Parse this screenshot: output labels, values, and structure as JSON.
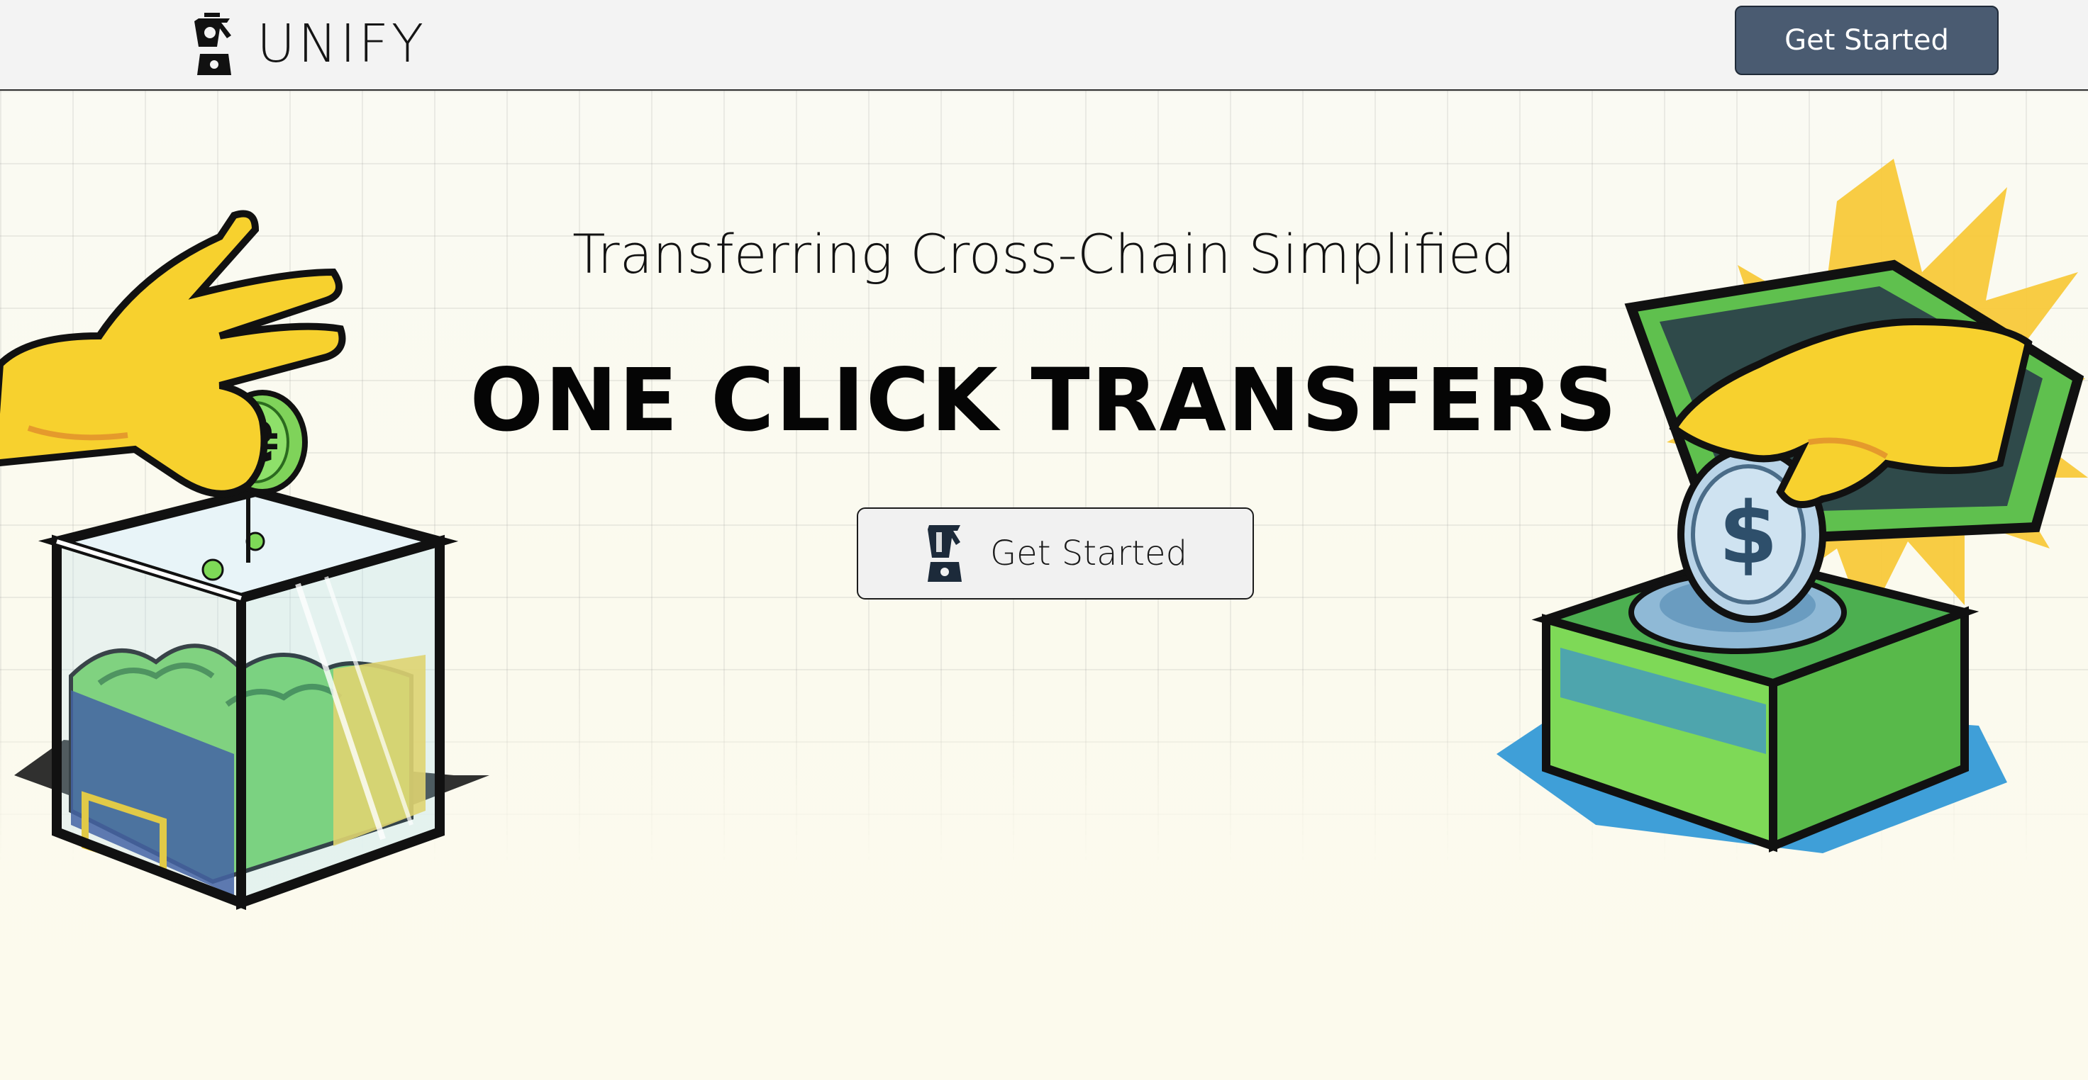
{
  "header": {
    "logo_text": "UNIFY",
    "logo_icon": "blender-icon",
    "cta_label": "Get Started"
  },
  "hero": {
    "tagline": "Transferring Cross-Chain Simplified",
    "headline": "ONE CLICK TRANSFERS",
    "cta_label": "Get Started",
    "cta_icon": "blender-icon"
  },
  "illustrations": {
    "left": "hand-dropping-coin-into-glass-box",
    "right": "hand-inserting-dollar-coin-into-green-box"
  },
  "colors": {
    "header_bg": "#f3f3f3",
    "nav_button_bg": "#4a5b71",
    "hero_button_bg": "#f1f1f1",
    "headline_text": "#050505",
    "accent_green": "#7ed957",
    "accent_yellow": "#f9c93c",
    "accent_blue": "#4aa3dc"
  }
}
